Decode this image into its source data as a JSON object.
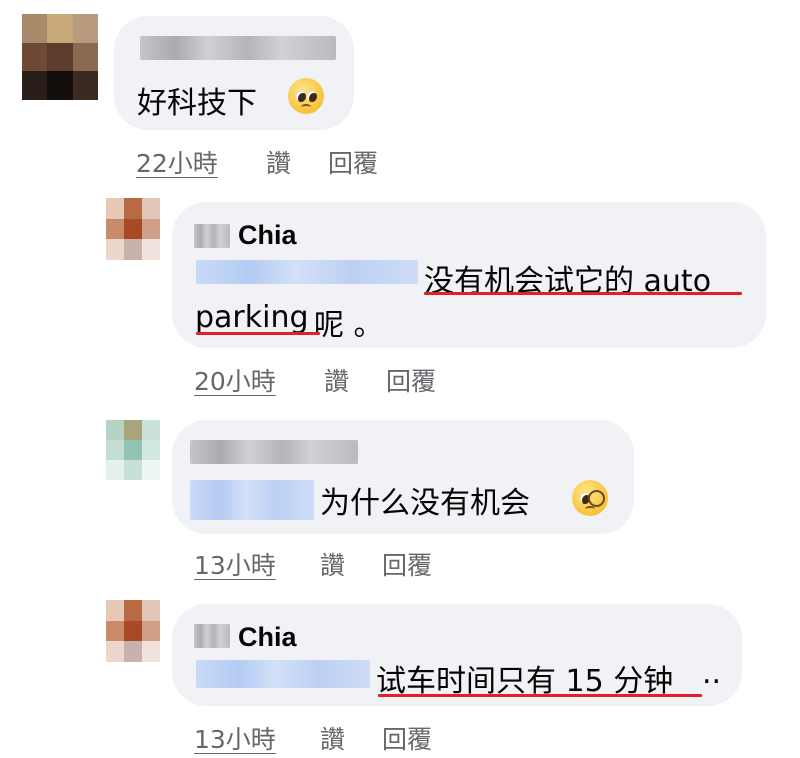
{
  "comments": [
    {
      "text": "好科技下",
      "emoji": "pleading-face",
      "time": "22小時",
      "like_label": "讚",
      "reply_label": "回覆"
    },
    {
      "author": "Chia",
      "text_line1": "没有机会试它的 auto",
      "text_line2": "parking",
      "text_line2_tail": "呢 。",
      "time": "20小時",
      "like_label": "讚",
      "reply_label": "回覆"
    },
    {
      "text": "为什么没有机会",
      "emoji": "face-with-monocle",
      "time": "13小時",
      "like_label": "讚",
      "reply_label": "回覆"
    },
    {
      "author": "Chia",
      "text": "试车时间只有 15 分钟",
      "text_tail": "..",
      "time": "13小時",
      "like_label": "讚",
      "reply_label": "回覆"
    }
  ],
  "colors": {
    "bubble": "#f0f2f5",
    "meta_text": "#65676b",
    "annotation_underline": "#e0202a"
  }
}
